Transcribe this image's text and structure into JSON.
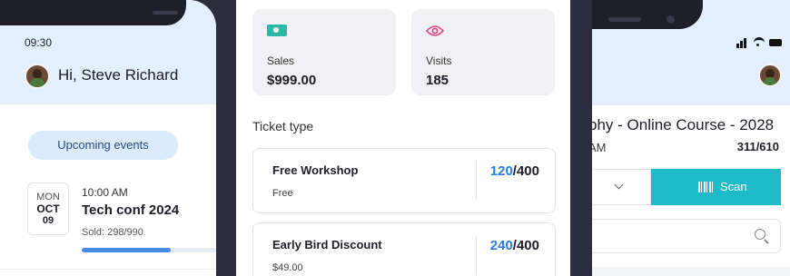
{
  "left_phone": {
    "status_time": "09:30",
    "greeting": "Hi, Steve Richard",
    "tab_label": "Upcoming events",
    "event": {
      "weekday": "MON",
      "month": "OCT",
      "day": "09",
      "time": "10:00 AM",
      "title": "Tech conf 2024",
      "sold": "Sold: 298/990",
      "sold_fraction": 0.301
    }
  },
  "stats": {
    "sales_label": "Sales",
    "sales_value": "$999.00",
    "visits_label": "Visits",
    "visits_value": "185"
  },
  "ticket_section_title": "Ticket type",
  "tickets": [
    {
      "name": "Free Workshop",
      "price": "Free",
      "sold": "120",
      "total": "/400"
    },
    {
      "name": "Early Bird Discount",
      "price": "$49.00",
      "sold": "240",
      "total": "/400"
    }
  ],
  "right_phone": {
    "course_title": "phy - Online Course - 2028",
    "course_time": "AM",
    "course_count": "311/610",
    "scan_label": "Scan"
  },
  "colors": {
    "header_bg": "#e3efff",
    "accent_blue": "#2a7de1",
    "scan_teal": "#1fbac8",
    "backdrop": "#2c2c3e"
  }
}
